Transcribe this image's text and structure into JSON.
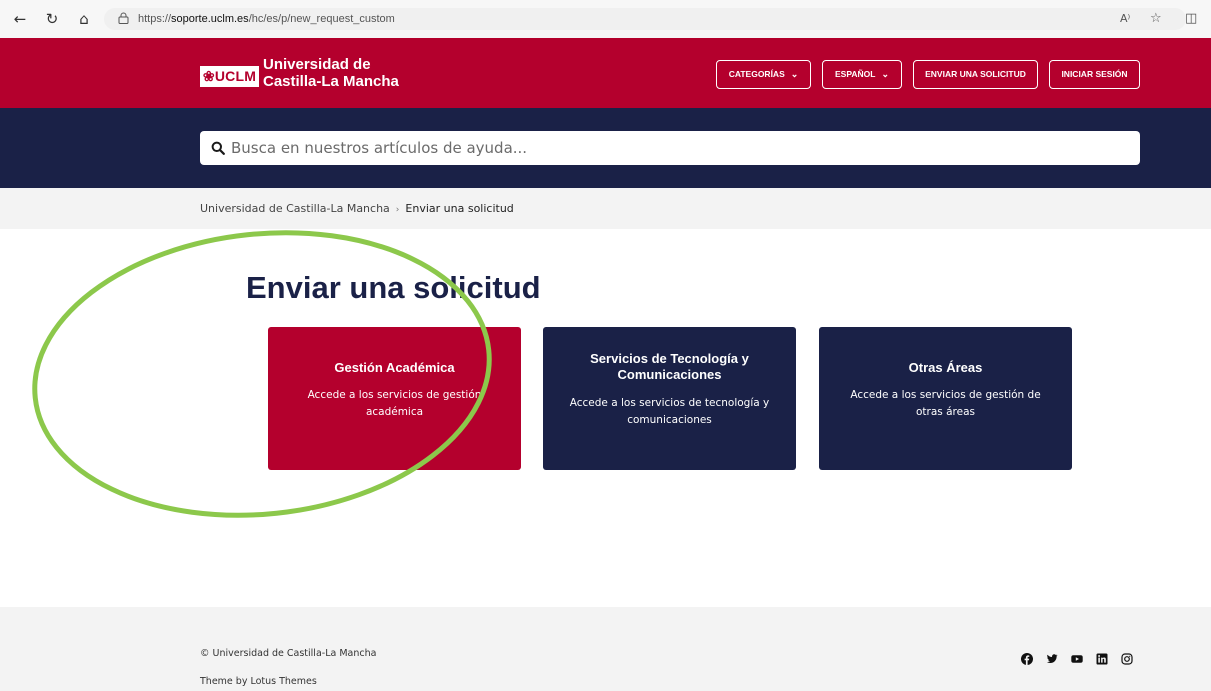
{
  "browser": {
    "url_prefix": "https://",
    "url_host": "soporte.uclm.es",
    "url_path": "/hc/es/p/new_request_custom",
    "reader_label": "A⁾"
  },
  "header": {
    "logo_mark": "❀UCLM",
    "logo_line1": "Universidad de",
    "logo_line2": "Castilla-La Mancha",
    "nav": {
      "categorias": "CATEGORÍAS",
      "espanol": "ESPAÑOL",
      "enviar": "ENVIAR UNA SOLICITUD",
      "iniciar": "INICIAR SESIÓN"
    },
    "brand_color": "#b4002d",
    "navy_color": "#1a2147"
  },
  "search": {
    "placeholder": "Busca en nuestros artículos de ayuda..."
  },
  "breadcrumb": {
    "home": "Universidad de Castilla-La Mancha",
    "separator": "›",
    "current": "Enviar una solicitud"
  },
  "main": {
    "title": "Enviar una solicitud",
    "cards": [
      {
        "title": "Gestión Académica",
        "description": "Accede a los servicios de gestión académica",
        "color": "#b4002d"
      },
      {
        "title": "Servicios de Tecnología y Comunicaciones",
        "description": "Accede a los servicios de tecnología y comunicaciones",
        "color": "#1a2147"
      },
      {
        "title": "Otras Áreas",
        "description": "Accede a los servicios de gestión de otras áreas",
        "color": "#1a2147"
      }
    ],
    "annotation_color": "#8cc84b"
  },
  "footer": {
    "copyright": "© Universidad de Castilla-La Mancha",
    "theme": "Theme by Lotus Themes",
    "social": [
      "facebook-icon",
      "twitter-icon",
      "youtube-icon",
      "linkedin-icon",
      "instagram-icon"
    ]
  }
}
